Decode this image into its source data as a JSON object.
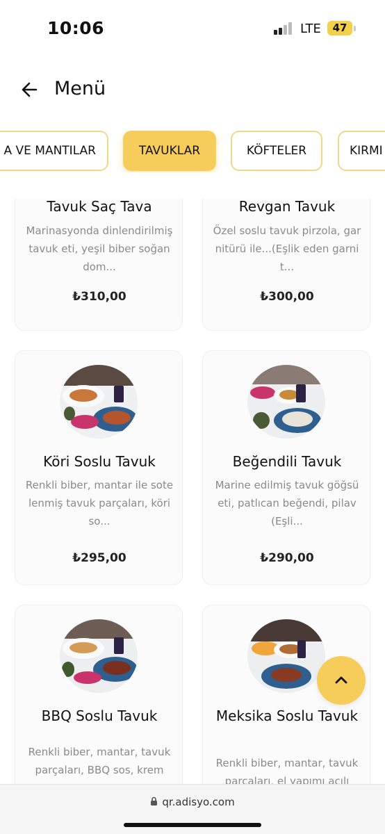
{
  "status": {
    "time": "10:06",
    "network": "LTE",
    "battery": "47"
  },
  "header": {
    "title": "Menü"
  },
  "tabs": [
    {
      "label": "A VE MANTILAR"
    },
    {
      "label": "TAVUKLAR",
      "active": true
    },
    {
      "label": "KÖFTELER"
    },
    {
      "label": "KIRMI"
    }
  ],
  "items": [
    {
      "name": "Tavuk Saç Tava",
      "desc": "Marinasyonda dinlendirilmiş tavuk eti, yeşil biber soğan dom...",
      "price": "₺310,00"
    },
    {
      "name": "Revgan Tavuk",
      "desc": "Özel soslu tavuk pirzola, garnitürü ile...(Eşlik eden garnit...",
      "price": "₺300,00"
    },
    {
      "name": "Köri Soslu Tavuk",
      "desc": "Renkli biber, mantar ile sotelenmiş tavuk parçaları, köri so...",
      "price": "₺295,00"
    },
    {
      "name": "Beğendili Tavuk",
      "desc": "Marine edilmiş tavuk göğsü eti, patlıcan beğendi, pilav(Eşli...",
      "price": "₺290,00"
    },
    {
      "name": "BBQ Soslu Tavuk",
      "desc": "Renkli biber, mantar, tavuk parçaları, BBQ sos, krem",
      "price": ""
    },
    {
      "name": "Meksika Soslu Tavuk",
      "desc": "Renkli biber, mantar, tavuk parçaları, el yapımı acılı",
      "price": ""
    }
  ],
  "browser": {
    "url": "qr.adisyo.com"
  },
  "colors": {
    "accent": "#f6cc5b",
    "tab_border": "#f1d78a",
    "desc_text": "#8a8a8a"
  }
}
